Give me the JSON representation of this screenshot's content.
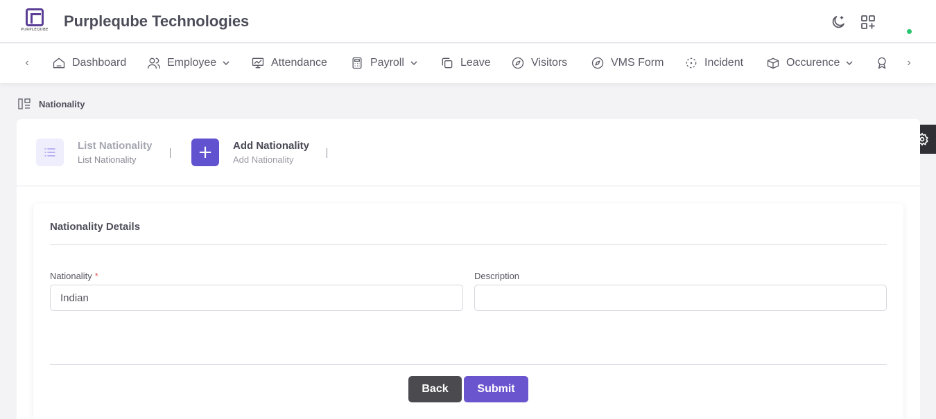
{
  "app": {
    "title": "Purpleqube Technologies",
    "logo_text": "PURPLEQUBE"
  },
  "header_icons": [
    "moon-icon",
    "apps-add-icon"
  ],
  "nav": {
    "items": [
      {
        "label": "Dashboard",
        "icon": "home-icon",
        "has_dropdown": false
      },
      {
        "label": "Employee",
        "icon": "users-icon",
        "has_dropdown": true
      },
      {
        "label": "Attendance",
        "icon": "presentation-icon",
        "has_dropdown": false
      },
      {
        "label": "Payroll",
        "icon": "calculator-icon",
        "has_dropdown": true
      },
      {
        "label": "Leave",
        "icon": "copy-icon",
        "has_dropdown": false
      },
      {
        "label": "Visitors",
        "icon": "compass-icon",
        "has_dropdown": false
      },
      {
        "label": "VMS Form",
        "icon": "compass-icon",
        "has_dropdown": false
      },
      {
        "label": "Incident",
        "icon": "focus-icon",
        "has_dropdown": false
      },
      {
        "label": "Occurence",
        "icon": "boxes-icon",
        "has_dropdown": true
      }
    ]
  },
  "breadcrumb": {
    "label": "Nationality"
  },
  "tabs": [
    {
      "title": "List Nationality",
      "subtitle": "List Nationality",
      "active": false
    },
    {
      "title": "Add Nationality",
      "subtitle": "Add Nationality",
      "active": true
    }
  ],
  "form": {
    "section_title": "Nationality Details",
    "nationality_label": "Nationality",
    "required_mark": "*",
    "nationality_value": "Indian",
    "description_label": "Description",
    "description_value": "",
    "back_label": "Back",
    "submit_label": "Submit"
  },
  "colors": {
    "accent": "#6152cf",
    "submit": "#6a55cf",
    "back": "#4b4b4f",
    "status_online": "#28c76f",
    "required": "#ea5455"
  }
}
